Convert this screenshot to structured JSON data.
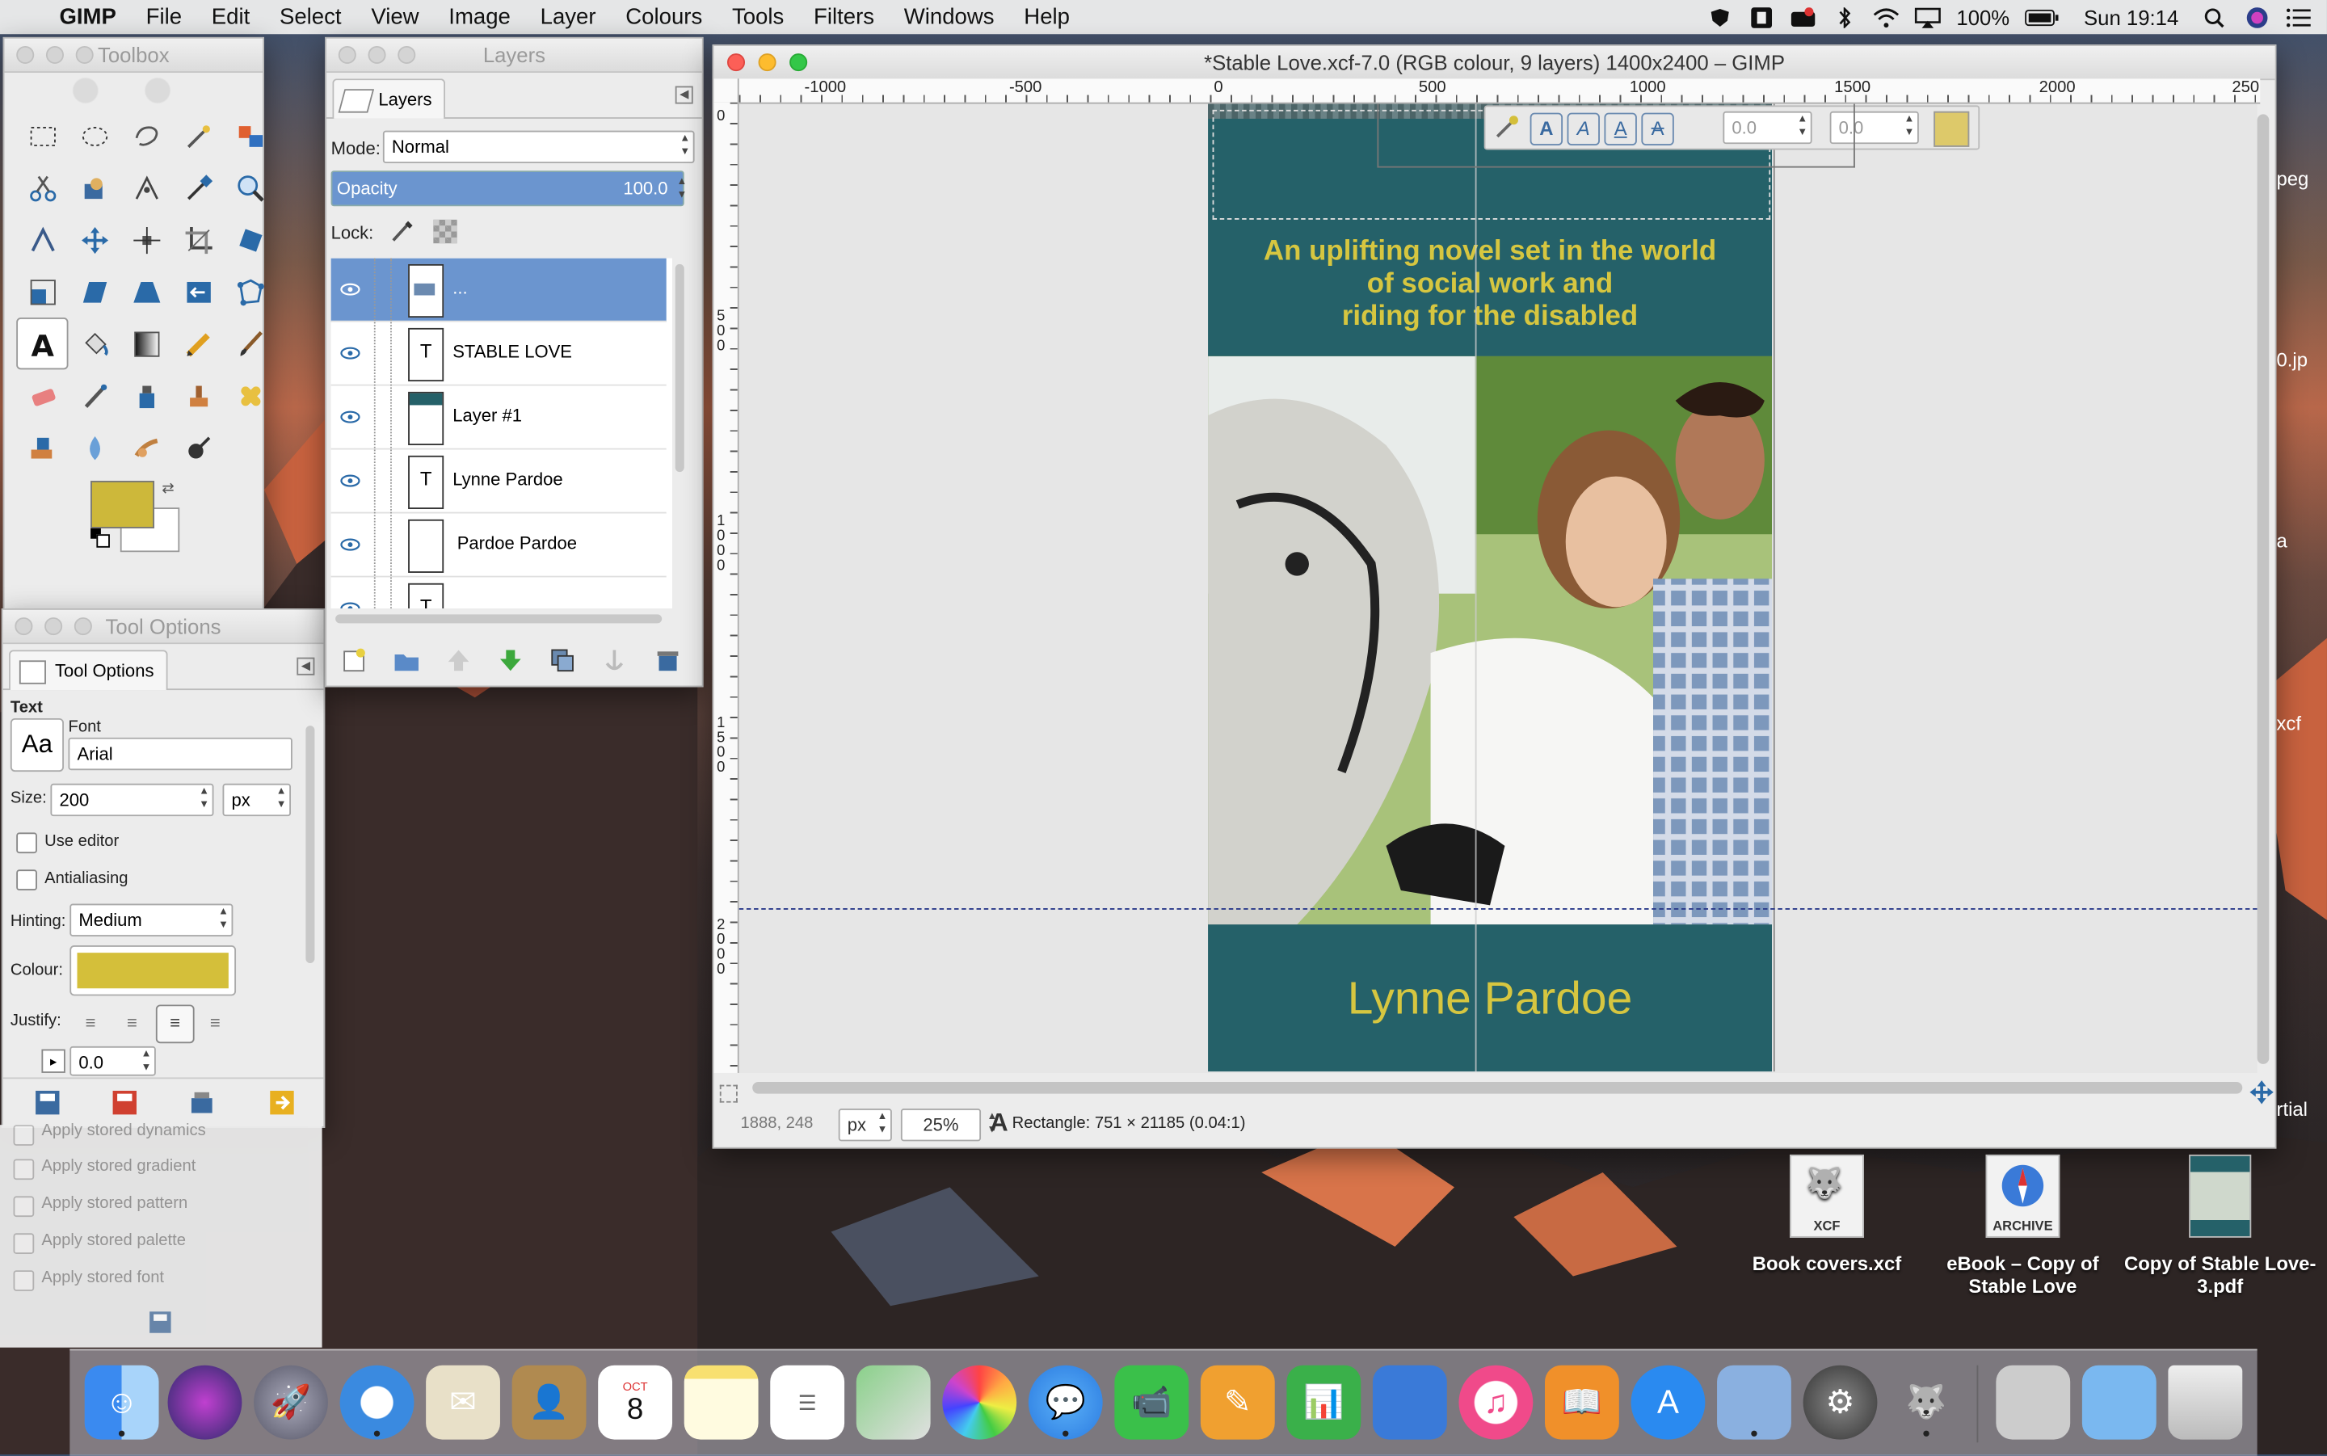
{
  "menubar": {
    "app_name": "GIMP",
    "items": [
      "File",
      "Edit",
      "Select",
      "View",
      "Image",
      "Layer",
      "Colours",
      "Tools",
      "Filters",
      "Windows",
      "Help"
    ],
    "battery": "100%",
    "clock": "Sun 19:14"
  },
  "toolbox": {
    "title": "Toolbox",
    "fg_color": "#cdb83a",
    "bg_color": "#ffffff"
  },
  "layers": {
    "title": "Layers",
    "tab_label": "Layers",
    "mode_label": "Mode:",
    "mode_value": "Normal",
    "opacity_label": "Opacity",
    "opacity_value": "100.0",
    "lock_label": "Lock:",
    "rows": [
      {
        "name": "...",
        "selected": true
      },
      {
        "name": "STABLE LOVE"
      },
      {
        "name": "Layer #1"
      },
      {
        "name": "Lynne Pardoe"
      },
      {
        "name": "Pardoe Pardoe"
      },
      {
        "name": ""
      }
    ]
  },
  "tool_options": {
    "title": "Tool Options",
    "tab_label": "Tool Options",
    "section": "Text",
    "font_label": "Font",
    "font_preview": "Aa",
    "font_value": "Arial",
    "size_label": "Size:",
    "size_value": "200",
    "size_unit": "px",
    "use_editor": "Use editor",
    "antialiasing": "Antialiasing",
    "hinting_label": "Hinting:",
    "hinting_value": "Medium",
    "colour_label": "Colour:",
    "colour_value": "#d4bf3a",
    "justify_label": "Justify:",
    "indent_value": "0.0",
    "hidden_options": [
      "Apply stored dynamics",
      "Apply stored gradient",
      "Apply stored pattern",
      "Apply stored palette",
      "Apply stored font"
    ]
  },
  "image_window": {
    "title": "*Stable Love.xcf-7.0 (RGB colour, 9 layers) 1400x2400 – GIMP",
    "ruler_h": [
      "-1000",
      "-500",
      "0",
      "500",
      "1000",
      "1500",
      "2000",
      "250"
    ],
    "ruler_v": [
      "0",
      "500",
      "1000",
      "1500",
      "2000"
    ],
    "text_toolbar": {
      "field1": "0.0",
      "field2": "0.0"
    },
    "cover": {
      "tagline": [
        "An uplifting novel set in the world",
        "of social work and",
        "riding for the disabled"
      ],
      "author": "Lynne Pardoe",
      "bg": "#256169",
      "text_color": "#d6c640"
    },
    "status": {
      "coords": "1888, 248",
      "unit": "px",
      "zoom": "25%",
      "message": "Rectangle: 751 × 21185  (0.04:1)"
    }
  },
  "desktop": {
    "edge_labels": [
      "peg",
      "0.jp",
      "a",
      "xcf",
      "rtial"
    ],
    "icons": [
      {
        "label": "Book covers.xcf",
        "badge": "XCF"
      },
      {
        "label": "eBook – Copy of Stable Love",
        "badge": "ARCHIVE"
      },
      {
        "label": "Copy of Stable Love-3.pdf",
        "badge": ""
      }
    ]
  },
  "dock": {
    "apps": [
      "Finder",
      "Siri",
      "Launchpad",
      "Safari",
      "Mail",
      "Contacts",
      "Calendar",
      "Notes",
      "Reminders",
      "Maps",
      "Photos",
      "Messages",
      "FaceTime",
      "Pages",
      "Numbers",
      "Keynote",
      "iTunes",
      "iBooks",
      "App Store",
      "Preview",
      "System Preferences",
      "GIMP",
      "Photo Folder",
      "Folder",
      "Trash"
    ],
    "calendar_month": "OCT",
    "calendar_day": "8"
  }
}
